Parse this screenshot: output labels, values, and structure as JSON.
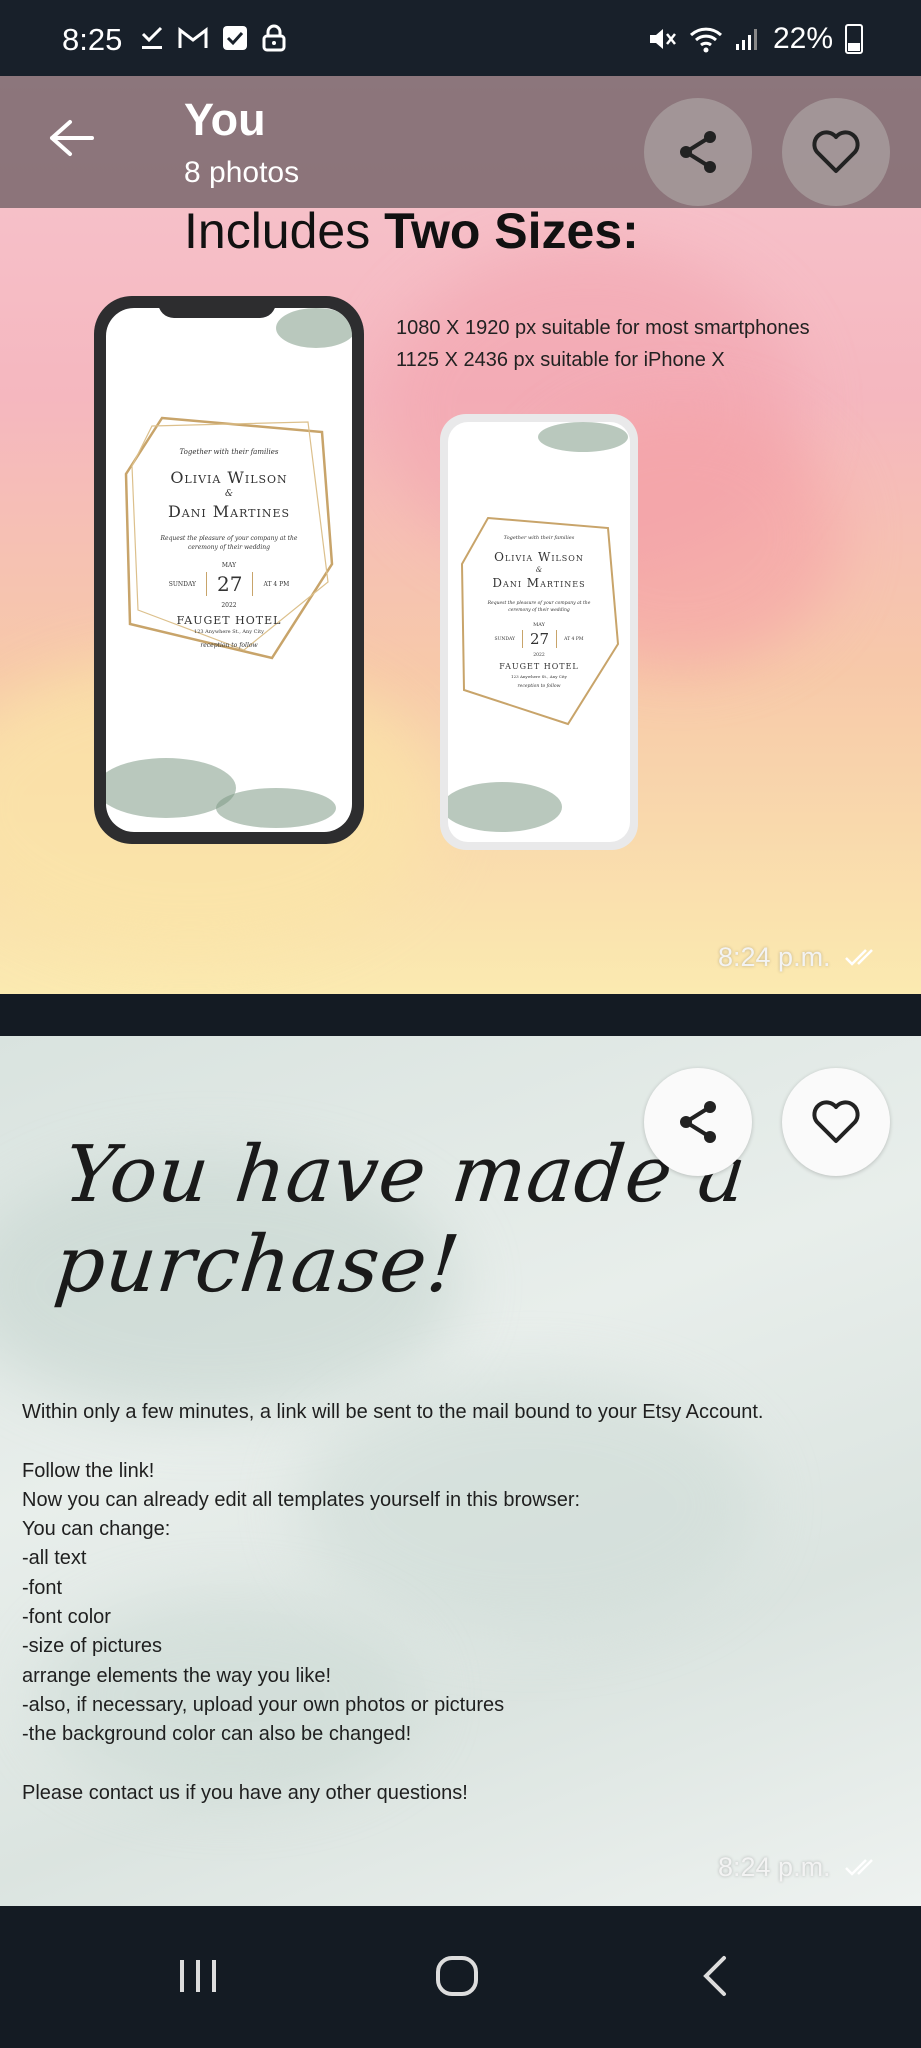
{
  "status_bar": {
    "time": "8:25",
    "battery": "22%"
  },
  "header": {
    "title": "You",
    "subtitle": "8 photos"
  },
  "photo1": {
    "heading_normal": "Includes ",
    "heading_bold": "Two Sizes:",
    "size_lines": [
      "1080 X 1920 px suitable for most smartphones",
      "1125 X 2436 px suitable for iPhone X"
    ],
    "invitation": {
      "intro": "Together with their families",
      "name1": "Olivia Wilson",
      "amp": "&",
      "name2": "Dani Martines",
      "request": "Request the pleasure of your company at the ceremony of their wedding",
      "month": "MAY",
      "day_left": "SUNDAY",
      "day": "27",
      "time_right": "AT 4 PM",
      "year": "2022",
      "venue": "FAUGET HOTEL",
      "address": "123 Anywhere St., Any City",
      "reception": "reception to follow"
    },
    "timestamp": "8:24 p.m."
  },
  "photo2": {
    "script_title": "You have made a purchase!",
    "lines": [
      "Within only a few minutes, a link will be sent to the mail bound to your Etsy Account.",
      "",
      "Follow the link!",
      "Now you can already edit all templates yourself in this browser:",
      "You can change:",
      "-all text",
      "-font",
      "-font color",
      "-size of pictures",
      "arrange elements the way you like!",
      "-also, if necessary, upload your own photos or pictures",
      "-the background color can also be changed!",
      "",
      "Please contact us if you have any other questions!"
    ],
    "timestamp": "8:24 p.m."
  },
  "icons": {
    "back": "arrow-left-icon",
    "share": "share-icon",
    "favorite": "heart-icon",
    "nav_recents": "recents-icon",
    "nav_home": "home-icon",
    "nav_back": "chevron-left-icon"
  }
}
